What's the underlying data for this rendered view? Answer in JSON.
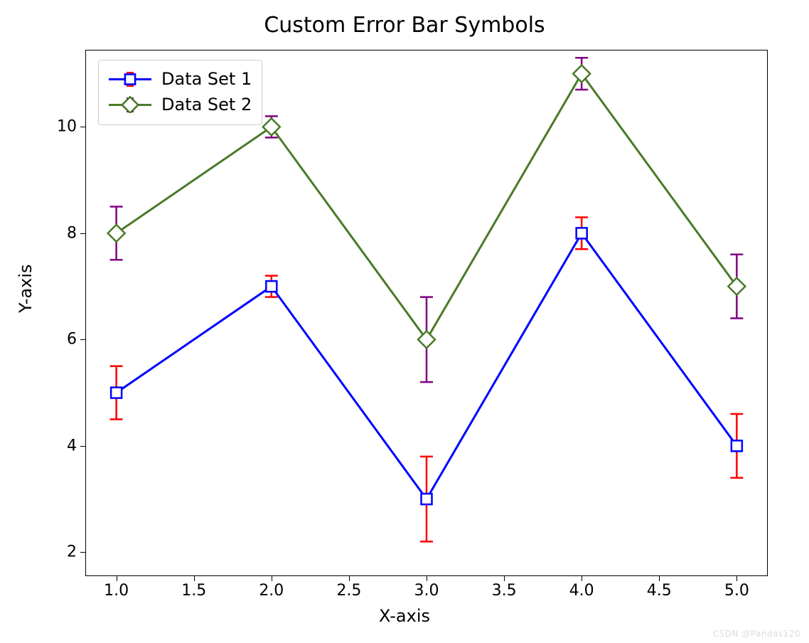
{
  "chart_data": {
    "type": "line",
    "title": "Custom Error Bar Symbols",
    "xlabel": "X-axis",
    "ylabel": "Y-axis",
    "x": [
      1,
      2,
      3,
      4,
      5
    ],
    "xticks": [
      "1.0",
      "1.5",
      "2.0",
      "2.5",
      "3.0",
      "3.5",
      "4.0",
      "4.5",
      "5.0"
    ],
    "yticks": [
      "2",
      "4",
      "6",
      "8",
      "10"
    ],
    "xlim": [
      0.8,
      5.2
    ],
    "ylim": [
      1.55,
      11.45
    ],
    "series": [
      {
        "name": "Data Set 1",
        "values": [
          5,
          7,
          3,
          8,
          4
        ],
        "errors": [
          0.5,
          0.2,
          0.8,
          0.3,
          0.6
        ],
        "line_color": "#0000ff",
        "marker": "square",
        "error_color": "#ff0000"
      },
      {
        "name": "Data Set 2",
        "values": [
          8,
          10,
          6,
          11,
          7
        ],
        "errors": [
          0.5,
          0.2,
          0.8,
          0.3,
          0.6
        ],
        "line_color": "#4a7a2a",
        "marker": "diamond",
        "error_color": "#800080"
      }
    ],
    "legend_position": "upper left"
  },
  "watermark": "CSDN @Pandas120"
}
